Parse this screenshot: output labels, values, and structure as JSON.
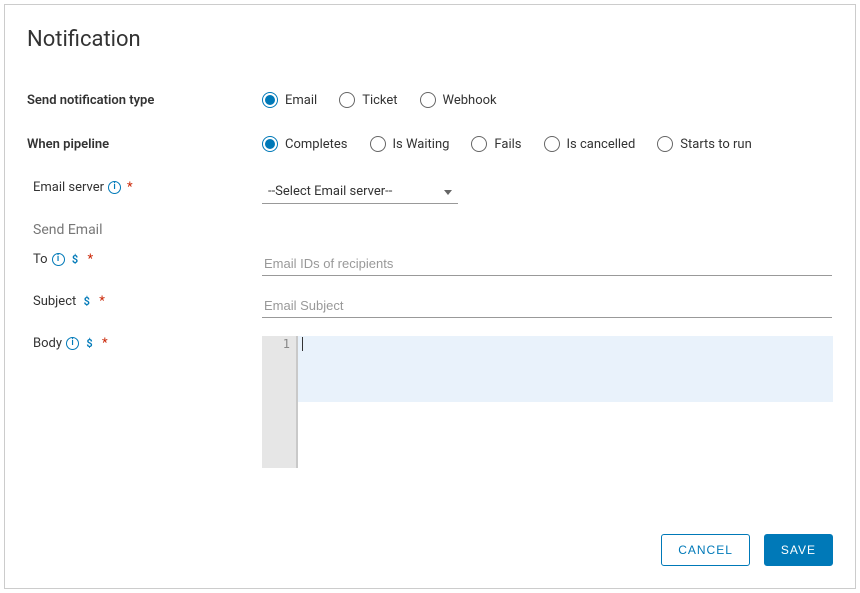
{
  "dialog": {
    "title": "Notification"
  },
  "notificationType": {
    "label": "Send notification type",
    "options": [
      "Email",
      "Ticket",
      "Webhook"
    ],
    "selected": "Email"
  },
  "whenPipeline": {
    "label": "When pipeline",
    "options": [
      "Completes",
      "Is Waiting",
      "Fails",
      "Is cancelled",
      "Starts to run"
    ],
    "selected": "Completes"
  },
  "emailServer": {
    "label": "Email server",
    "placeholder": "--Select Email server--"
  },
  "sendEmail": {
    "heading": "Send Email"
  },
  "to": {
    "label": "To",
    "placeholder": "Email IDs of recipients"
  },
  "subject": {
    "label": "Subject",
    "placeholder": "Email Subject"
  },
  "body": {
    "label": "Body",
    "lineNumber": "1"
  },
  "icons": {
    "info": "i",
    "dollar": "$",
    "required": "*"
  },
  "buttons": {
    "cancel": "CANCEL",
    "save": "SAVE"
  }
}
